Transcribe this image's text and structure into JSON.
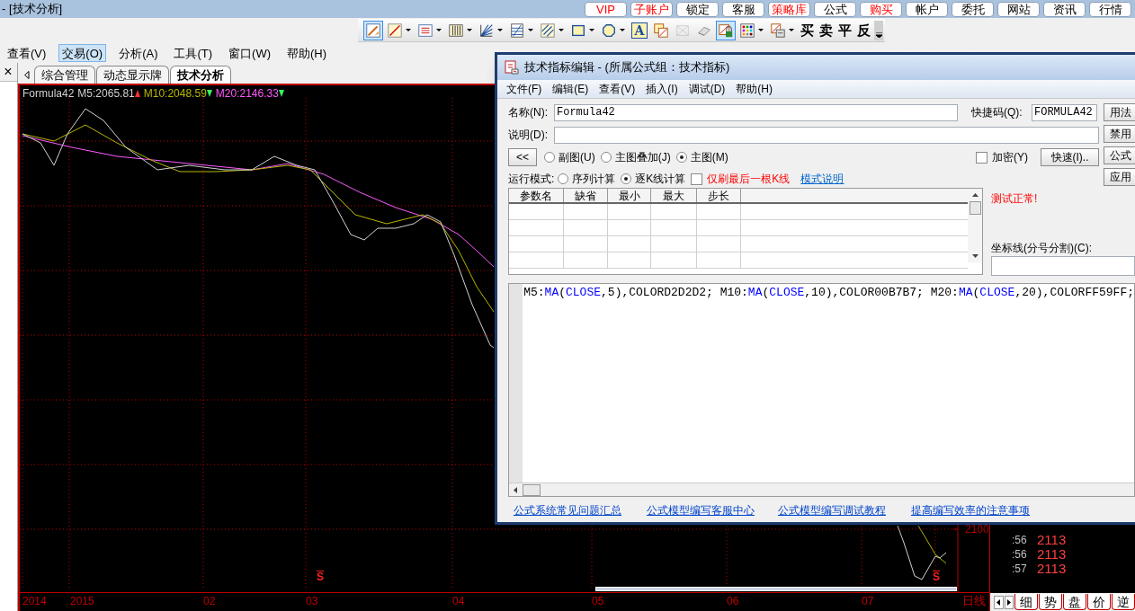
{
  "window": {
    "title": "- [技术分析]"
  },
  "top_buttons": [
    {
      "label": "VIP",
      "highlight": true
    },
    {
      "label": "子账户",
      "highlight": true
    },
    {
      "label": "锁定",
      "highlight": false
    },
    {
      "label": "客服",
      "highlight": false
    },
    {
      "label": "策略库",
      "highlight": true
    },
    {
      "label": "公式",
      "highlight": false
    },
    {
      "label": "购买",
      "highlight": true
    },
    {
      "label": "帐户",
      "highlight": false
    },
    {
      "label": "委托",
      "highlight": false
    },
    {
      "label": "网站",
      "highlight": false
    },
    {
      "label": "资讯",
      "highlight": false
    },
    {
      "label": "行情",
      "highlight": false
    }
  ],
  "toolbar": {
    "tools": [
      {
        "kind": "icon",
        "selected": true,
        "dropdown": false,
        "disabled": false
      },
      {
        "kind": "icon",
        "selected": false,
        "dropdown": true,
        "disabled": false
      },
      {
        "kind": "icon",
        "selected": false,
        "dropdown": true,
        "disabled": false
      },
      {
        "kind": "icon",
        "selected": false,
        "dropdown": true,
        "disabled": false
      },
      {
        "kind": "icon",
        "selected": false,
        "dropdown": true,
        "disabled": false
      },
      {
        "kind": "icon",
        "selected": false,
        "dropdown": true,
        "disabled": false
      },
      {
        "kind": "icon",
        "selected": false,
        "dropdown": true,
        "disabled": false
      },
      {
        "kind": "icon",
        "selected": false,
        "dropdown": true,
        "disabled": false
      },
      {
        "kind": "icon",
        "selected": false,
        "dropdown": true,
        "disabled": false
      },
      {
        "kind": "glyph",
        "label": "A",
        "selected": false,
        "dropdown": false,
        "disabled": false
      },
      {
        "kind": "icon",
        "selected": false,
        "dropdown": false,
        "disabled": false
      },
      {
        "kind": "icon",
        "selected": false,
        "dropdown": false,
        "disabled": true
      },
      {
        "kind": "icon",
        "selected": false,
        "dropdown": false,
        "disabled": false
      },
      {
        "kind": "icon",
        "selected": true,
        "dropdown": false,
        "disabled": false
      },
      {
        "kind": "icon",
        "selected": false,
        "dropdown": true,
        "disabled": false
      },
      {
        "kind": "icon",
        "selected": false,
        "dropdown": true,
        "disabled": false
      }
    ],
    "trade_buttons": [
      "买",
      "卖",
      "平",
      "反"
    ]
  },
  "menu": [
    {
      "label": "查看(V)",
      "selected": false
    },
    {
      "label": "交易(O)",
      "selected": true
    },
    {
      "label": "分析(A)",
      "selected": false
    },
    {
      "label": "工具(T)",
      "selected": false
    },
    {
      "label": "窗口(W)",
      "selected": false
    },
    {
      "label": "帮助(H)",
      "selected": false
    }
  ],
  "left_panel": {
    "close": "×"
  },
  "tabs": [
    {
      "label": "综合管理",
      "selected": false
    },
    {
      "label": "动态显示牌",
      "selected": false
    },
    {
      "label": "技术分析",
      "selected": true
    }
  ],
  "chart": {
    "legend": {
      "name": "Formula42",
      "series": [
        {
          "label": "M5:2065.81",
          "color": "#d2d2d2",
          "rising": true
        },
        {
          "label": "M10:2048.59",
          "color": "#b7b700",
          "rising": false
        },
        {
          "label": "M20:2146.33",
          "color": "#ff59ff",
          "rising": false
        }
      ]
    },
    "price_label": "2100",
    "signal_markers": [
      "S",
      "S"
    ],
    "x_labels": [
      "2014",
      "2015",
      "02",
      "03",
      "04",
      "05",
      "06",
      "07"
    ],
    "period": "日线"
  },
  "ticks": [
    {
      "time": ":56",
      "price": "2113"
    },
    {
      "time": ":56",
      "price": "2113"
    },
    {
      "time": ":57",
      "price": "2113"
    }
  ],
  "side_tabs": [
    "细",
    "势",
    "盘",
    "价",
    "逆"
  ],
  "dialog": {
    "title": "技术指标编辑 - (所属公式组：技术指标)",
    "menu": [
      "文件(F)",
      "编辑(E)",
      "查看(V)",
      "插入(I)",
      "调试(D)",
      "帮助(H)"
    ],
    "name_label": "名称(N):",
    "name_value": "Formula42",
    "hotkey_label": "快捷码(Q):",
    "hotkey_value": "FORMULA42",
    "desc_label": "说明(D):",
    "collapse_button": "<<",
    "chart_types": [
      {
        "label": "副图(U)",
        "selected": false
      },
      {
        "label": "主图叠加(J)",
        "selected": false
      },
      {
        "label": "主图(M)",
        "selected": true
      }
    ],
    "encrypt": {
      "label": "加密(Y)",
      "checked": false
    },
    "quick_button": "快速(I)..",
    "side_buttons": [
      "用法",
      "禁用",
      "公式",
      "应用"
    ],
    "run_mode_label": "运行模式:",
    "run_modes": [
      {
        "label": "序列计算",
        "selected": false
      },
      {
        "label": "逐K线计算",
        "selected": true
      }
    ],
    "refresh_last": {
      "label": "仅刷最后一根K线",
      "checked": false
    },
    "mode_help_link": "模式说明",
    "param_columns": [
      "参数名",
      "缺省",
      "最小",
      "最大",
      "步长"
    ],
    "test_status": "测试正常!",
    "axis_lines_label": "坐标线(分号分割)(C):",
    "code": [
      {
        "text": "M5:",
        "kind": "plain"
      },
      {
        "text": "MA",
        "kind": "function"
      },
      {
        "text": "(",
        "kind": "plain"
      },
      {
        "text": "CLOSE",
        "kind": "function"
      },
      {
        "text": ",5),COLORD2D2D2; M10:",
        "kind": "plain"
      },
      {
        "text": "MA",
        "kind": "function"
      },
      {
        "text": "(",
        "kind": "plain"
      },
      {
        "text": "CLOSE",
        "kind": "function"
      },
      {
        "text": ",10),COLOR00B7B7; M20:",
        "kind": "plain"
      },
      {
        "text": "MA",
        "kind": "function"
      },
      {
        "text": "(",
        "kind": "plain"
      },
      {
        "text": "CLOSE",
        "kind": "function"
      },
      {
        "text": ",20),COLORFF59FF;",
        "kind": "plain"
      }
    ],
    "links": [
      "公式系统常见问题汇总",
      "公式模型编写客服中心",
      "公式模型编写调试教程",
      "提高编写效率的注意事项"
    ]
  }
}
